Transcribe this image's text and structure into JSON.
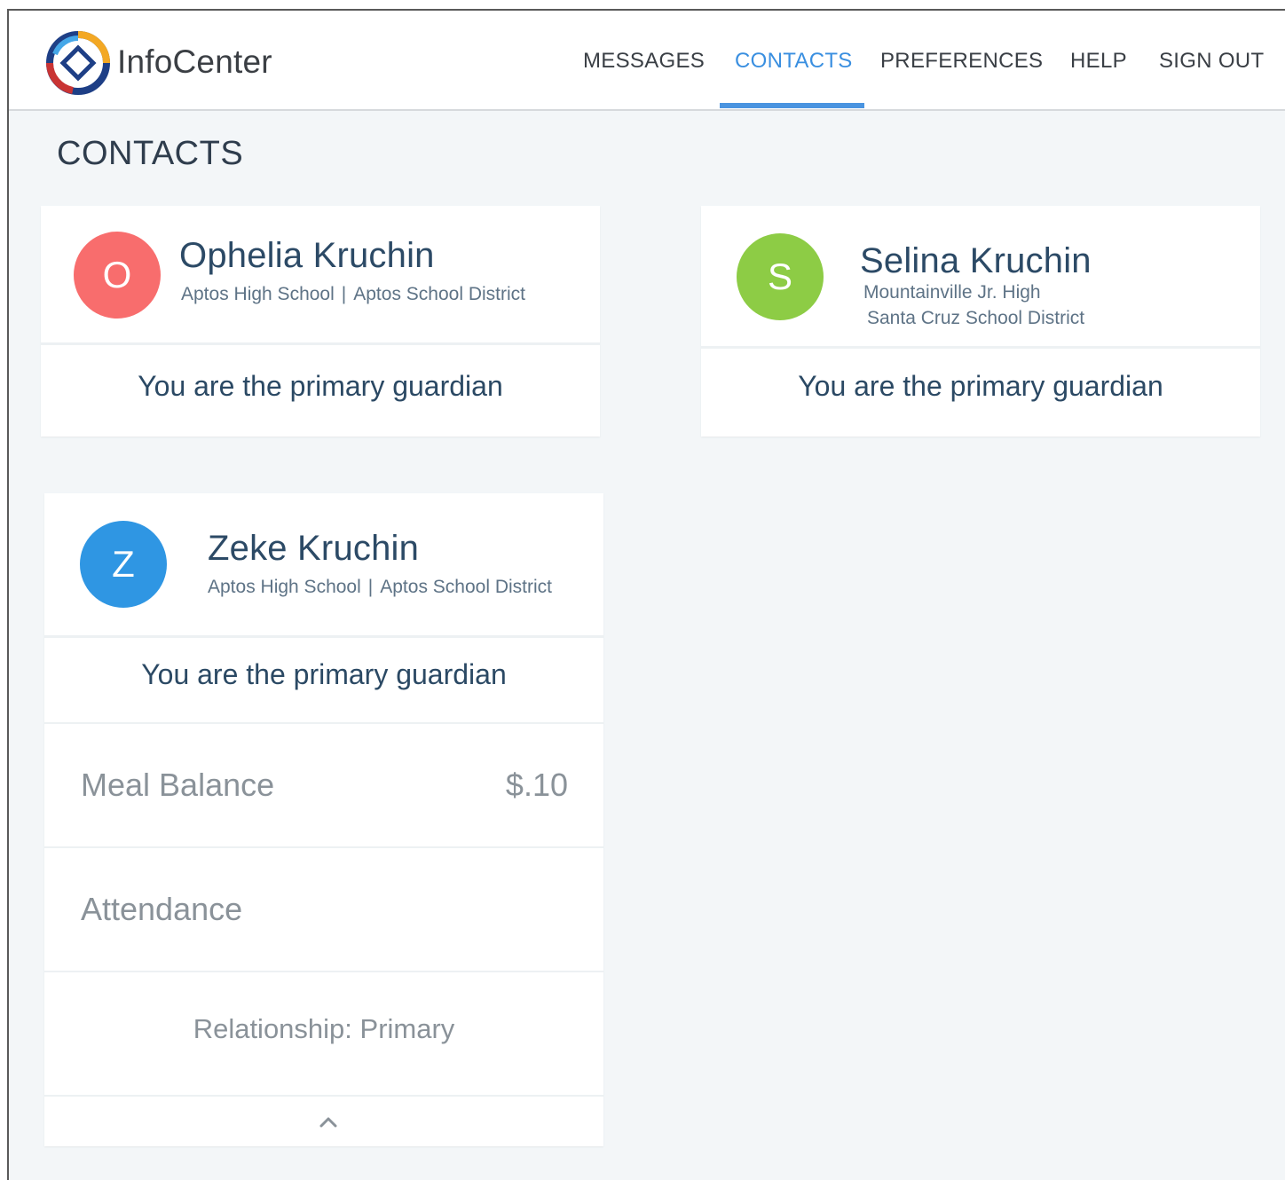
{
  "app": {
    "brand": "InfoCenter"
  },
  "nav": {
    "items": [
      {
        "label": "MESSAGES",
        "active": false
      },
      {
        "label": "CONTACTS",
        "active": true
      },
      {
        "label": "PREFERENCES",
        "active": false
      },
      {
        "label": "HELP",
        "active": false
      },
      {
        "label": "SIGN OUT",
        "active": false
      }
    ]
  },
  "page": {
    "title": "CONTACTS"
  },
  "contacts": [
    {
      "initial": "O",
      "name": "Ophelia Kruchin",
      "school": "Aptos High School",
      "separator": "|",
      "district": "Aptos School District",
      "guardian": "You are the primary guardian",
      "avatar_color": "#f86d6d"
    },
    {
      "initial": "S",
      "name": "Selina Kruchin",
      "school": "Mountainville Jr. High",
      "district": "Santa Cruz School District",
      "guardian": "You are the primary guardian",
      "avatar_color": "#8dcc45"
    },
    {
      "initial": "Z",
      "name": "Zeke Kruchin",
      "school": "Aptos High School",
      "separator": "|",
      "district": "Aptos School District",
      "guardian": "You are the primary guardian",
      "avatar_color": "#2f96e3",
      "meal_balance_label": "Meal Balance",
      "meal_balance_value": "$.10",
      "attendance_label": "Attendance",
      "relationship": "Relationship: Primary"
    }
  ],
  "icons": {
    "logo": "infocenter-logo",
    "collapse": "chevron-up-icon"
  },
  "colors": {
    "accent": "#3a8fe0",
    "page_bg": "#f3f6f8",
    "name": "#2c4a66"
  }
}
